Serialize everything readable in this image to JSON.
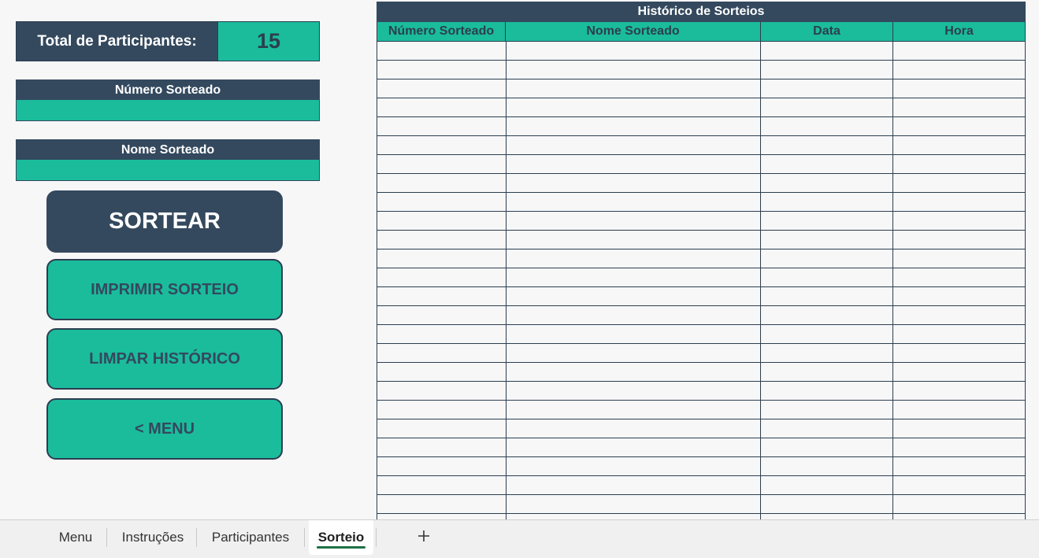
{
  "panel": {
    "total_label": "Total de Participantes:",
    "total_value": "15",
    "numero_label": "Número Sorteado",
    "numero_value": "",
    "nome_label": "Nome Sorteado",
    "nome_value": ""
  },
  "buttons": {
    "sortear": "SORTEAR",
    "imprimir": "IMPRIMIR SORTEIO",
    "limpar": "LIMPAR HISTÓRICO",
    "menu": "< MENU"
  },
  "history": {
    "title": "Histórico de Sorteios",
    "columns": [
      "Número Sorteado",
      "Nome Sorteado",
      "Data",
      "Hora"
    ],
    "rows": [
      [
        "",
        "",
        "",
        ""
      ],
      [
        "",
        "",
        "",
        ""
      ],
      [
        "",
        "",
        "",
        ""
      ],
      [
        "",
        "",
        "",
        ""
      ],
      [
        "",
        "",
        "",
        ""
      ],
      [
        "",
        "",
        "",
        ""
      ],
      [
        "",
        "",
        "",
        ""
      ],
      [
        "",
        "",
        "",
        ""
      ],
      [
        "",
        "",
        "",
        ""
      ],
      [
        "",
        "",
        "",
        ""
      ],
      [
        "",
        "",
        "",
        ""
      ],
      [
        "",
        "",
        "",
        ""
      ],
      [
        "",
        "",
        "",
        ""
      ],
      [
        "",
        "",
        "",
        ""
      ],
      [
        "",
        "",
        "",
        ""
      ],
      [
        "",
        "",
        "",
        ""
      ],
      [
        "",
        "",
        "",
        ""
      ],
      [
        "",
        "",
        "",
        ""
      ],
      [
        "",
        "",
        "",
        ""
      ],
      [
        "",
        "",
        "",
        ""
      ],
      [
        "",
        "",
        "",
        ""
      ],
      [
        "",
        "",
        "",
        ""
      ],
      [
        "",
        "",
        "",
        ""
      ],
      [
        "",
        "",
        "",
        ""
      ],
      [
        "",
        "",
        "",
        ""
      ],
      [
        "",
        "",
        "",
        ""
      ]
    ]
  },
  "tabs": [
    {
      "label": "Menu",
      "active": false
    },
    {
      "label": "Instruções",
      "active": false
    },
    {
      "label": "Participantes",
      "active": false
    },
    {
      "label": "Sorteio",
      "active": true
    }
  ],
  "add_tab_icon": "plus-icon",
  "colors": {
    "dark": "#34495e",
    "accent": "#1abc9c",
    "background": "#f7f7f8",
    "active_tab_underline": "#1e7145"
  }
}
